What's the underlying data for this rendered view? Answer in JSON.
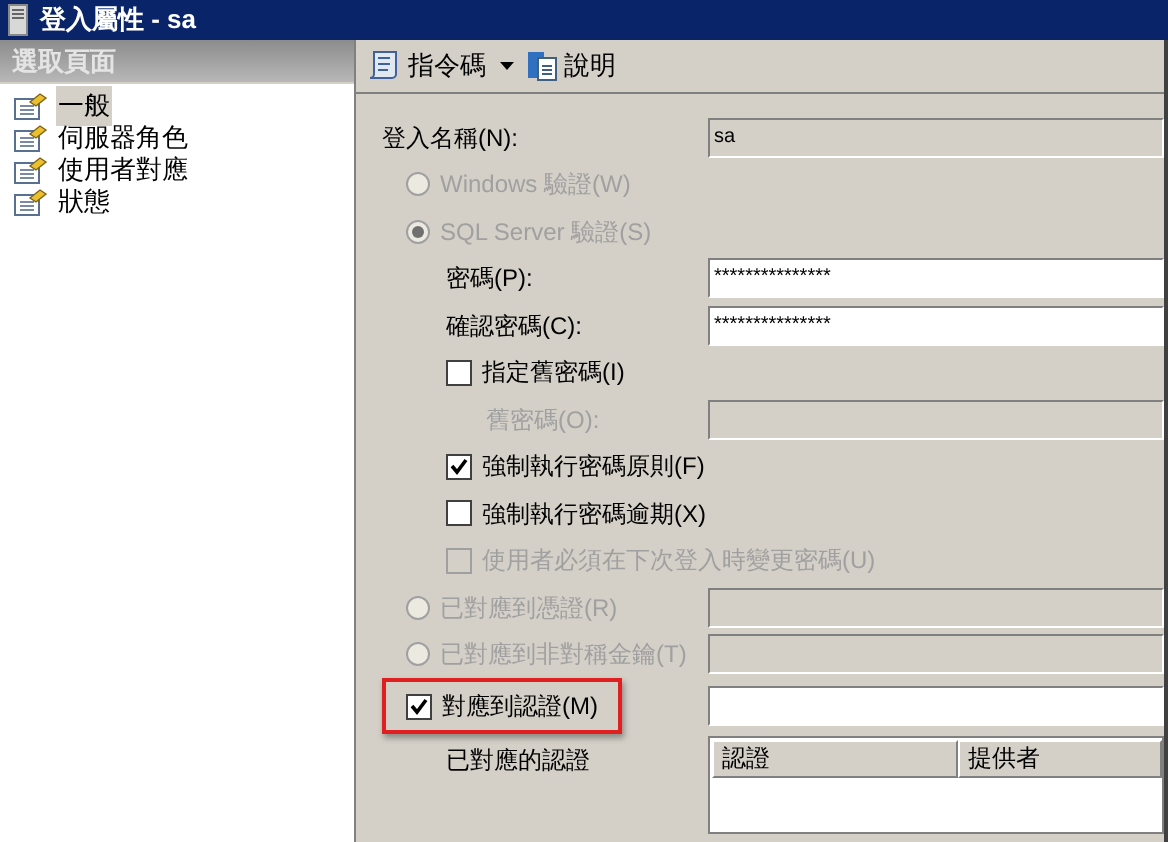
{
  "window": {
    "title": "登入屬性 - sa"
  },
  "sidebar": {
    "header": "選取頁面",
    "items": [
      {
        "label": "一般",
        "selected": true
      },
      {
        "label": "伺服器角色",
        "selected": false
      },
      {
        "label": "使用者對應",
        "selected": false
      },
      {
        "label": "狀態",
        "selected": false
      }
    ]
  },
  "toolbar": {
    "buttons": [
      {
        "label": "指令碼",
        "kind": "script",
        "dropdown": true
      },
      {
        "label": "說明",
        "kind": "help",
        "dropdown": false
      }
    ]
  },
  "form": [
    {
      "kind": "field",
      "label": "登入名稱(N):",
      "value": "sa",
      "disabled": false,
      "field_disabled": true
    },
    {
      "kind": "radio",
      "label": "Windows 驗證(W)",
      "selected": false,
      "disabled": true
    },
    {
      "kind": "radio",
      "label": "SQL Server 驗證(S)",
      "selected": true,
      "disabled": true,
      "children": [
        {
          "kind": "field",
          "label": "密碼(P):",
          "value": "***************",
          "disabled": false,
          "field_disabled": false
        },
        {
          "kind": "field",
          "label": "確認密碼(C):",
          "value": "***************",
          "disabled": false,
          "field_disabled": false
        },
        {
          "kind": "checkbox",
          "label": "指定舊密碼(I)",
          "checked": false,
          "disabled": false,
          "children": [
            {
              "kind": "field",
              "label": "舊密碼(O):",
              "disabled": true,
              "field_disabled": true
            }
          ]
        },
        {
          "kind": "checkbox",
          "label": "強制執行密碼原則(F)",
          "checked": true,
          "disabled": false
        },
        {
          "kind": "checkbox",
          "label": "強制執行密碼逾期(X)",
          "checked": false,
          "disabled": false
        },
        {
          "kind": "checkbox",
          "label": "使用者必須在下次登入時變更密碼(U)",
          "checked": false,
          "disabled": true
        }
      ]
    },
    {
      "kind": "radio",
      "label": "已對應到憑證(R)",
      "selected": false,
      "disabled": true,
      "field_disabled": true
    },
    {
      "kind": "radio",
      "label": "已對應到非對稱金鑰(T)",
      "selected": false,
      "disabled": true,
      "field_disabled": true
    },
    {
      "kind": "checkbox",
      "label": "對應到認證(M)",
      "checked": true,
      "disabled": false,
      "highlighted": true,
      "field_disabled": false,
      "children": [
        {
          "kind": "table",
          "label": "已對應的認證",
          "columns": [
            "認證",
            "提供者"
          ]
        }
      ]
    }
  ]
}
